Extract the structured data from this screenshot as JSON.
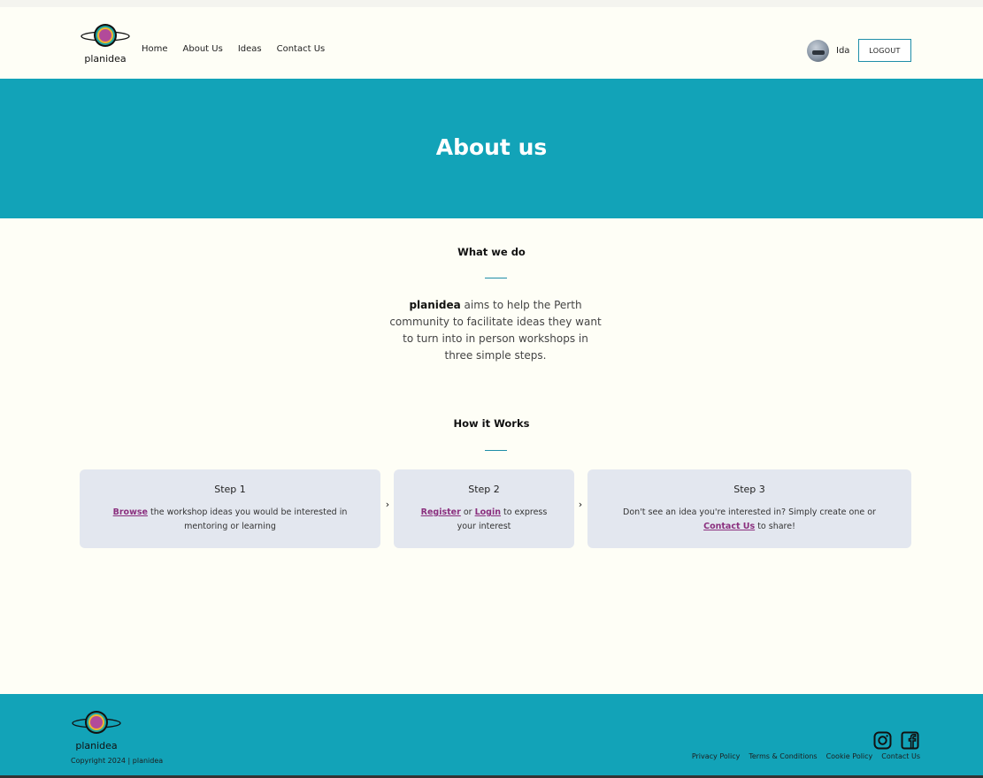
{
  "header": {
    "logo_text": "planidea",
    "nav": [
      {
        "label": "Home"
      },
      {
        "label": "About Us"
      },
      {
        "label": "Ideas"
      },
      {
        "label": "Contact Us"
      }
    ],
    "user_name": "Ida",
    "logout_label": "LOGOUT"
  },
  "hero": {
    "title": "About us"
  },
  "what_we_do": {
    "title": "What we do",
    "brand": "planidea",
    "text": " aims to help the Perth community to facilitate ideas they want to turn into in person workshops in three simple steps."
  },
  "how_it_works": {
    "title": "How it Works",
    "arrow": "›",
    "steps": [
      {
        "title": "Step 1",
        "link1": "Browse",
        "text1": " the workshop ideas you would be interested in mentoring or learning"
      },
      {
        "title": "Step 2",
        "link1": "Register",
        "text1": " or ",
        "link2": "Login",
        "text2": " to express your interest"
      },
      {
        "title": "Step 3",
        "text0": "Don't see an idea you're interested in? Simply create one or ",
        "link1": "Contact Us",
        "text1": " to share!"
      }
    ]
  },
  "footer": {
    "logo_text": "planidea",
    "copyright": "Copyright 2024 | planidea",
    "social": [
      "instagram-icon",
      "facebook-icon"
    ],
    "links": [
      {
        "label": "Privacy Policy"
      },
      {
        "label": "Terms & Conditions"
      },
      {
        "label": "Cookie Policy"
      },
      {
        "label": "Contact Us"
      }
    ]
  },
  "colors": {
    "accent": "#12a3b8",
    "background": "#fefef6",
    "link": "#8a2f7e",
    "card": "#e3e7ef"
  }
}
